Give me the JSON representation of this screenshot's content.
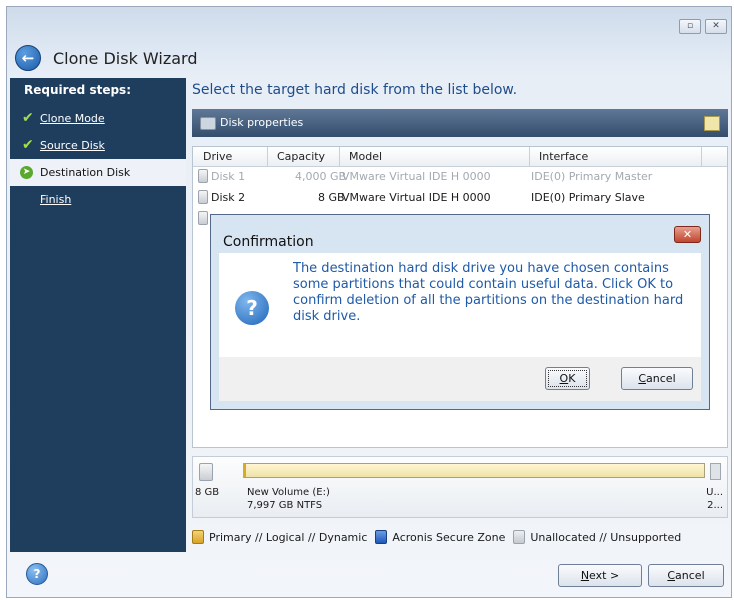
{
  "window": {
    "title": "Clone Disk Wizard",
    "controls": {
      "restore": "▫",
      "close": "✕"
    }
  },
  "sidebar": {
    "heading": "Required steps:",
    "steps": [
      {
        "label": "Clone Mode",
        "state": "done"
      },
      {
        "label": "Source Disk",
        "state": "done"
      },
      {
        "label": "Destination Disk",
        "state": "current"
      },
      {
        "label": "Finish",
        "state": "pending"
      }
    ]
  },
  "main": {
    "instruction": "Select the target hard disk from the list below.",
    "panel_label": "Disk properties",
    "columns": [
      "Drive",
      "Capacity",
      "Model",
      "Interface"
    ],
    "rows": [
      {
        "drive": "Disk 1",
        "capacity": "4,000 GB",
        "model": "VMware Virtual IDE H 0000",
        "interface": "IDE(0) Primary Master",
        "disabled": true
      },
      {
        "drive": "Disk 2",
        "capacity": "8 GB",
        "model": "VMware Virtual IDE H 0000",
        "interface": "IDE(0) Primary Slave",
        "disabled": false
      }
    ]
  },
  "volume": {
    "disk_size": "8 GB",
    "name": "New Volume (E:)",
    "fs_info": "7,997 GB  NTFS",
    "truncated_name": "U...",
    "truncated_size": "2..."
  },
  "legend": [
    {
      "label": "Primary // Logical // Dynamic",
      "color": "#e6b93a"
    },
    {
      "label": "Acronis Secure Zone",
      "color": "#2f6ecf"
    },
    {
      "label": "Unallocated // Unsupported",
      "color": "#c9cdd3"
    }
  ],
  "footer": {
    "next_prefix": "",
    "next_mnemonic": "N",
    "next_rest": "ext >",
    "cancel_mnemonic": "C",
    "cancel_rest": "ancel"
  },
  "dialog": {
    "title": "Confirmation",
    "close": "✕",
    "message": "The destination hard disk drive you have chosen contains some partitions that could contain useful data. Click OK to confirm deletion of all the partitions on the destination hard disk drive.",
    "ok_mnemonic": "O",
    "ok_rest": "K",
    "cancel_mnemonic": "C",
    "cancel_rest": "ancel",
    "icon_glyph": "?"
  },
  "help_glyph": "?"
}
